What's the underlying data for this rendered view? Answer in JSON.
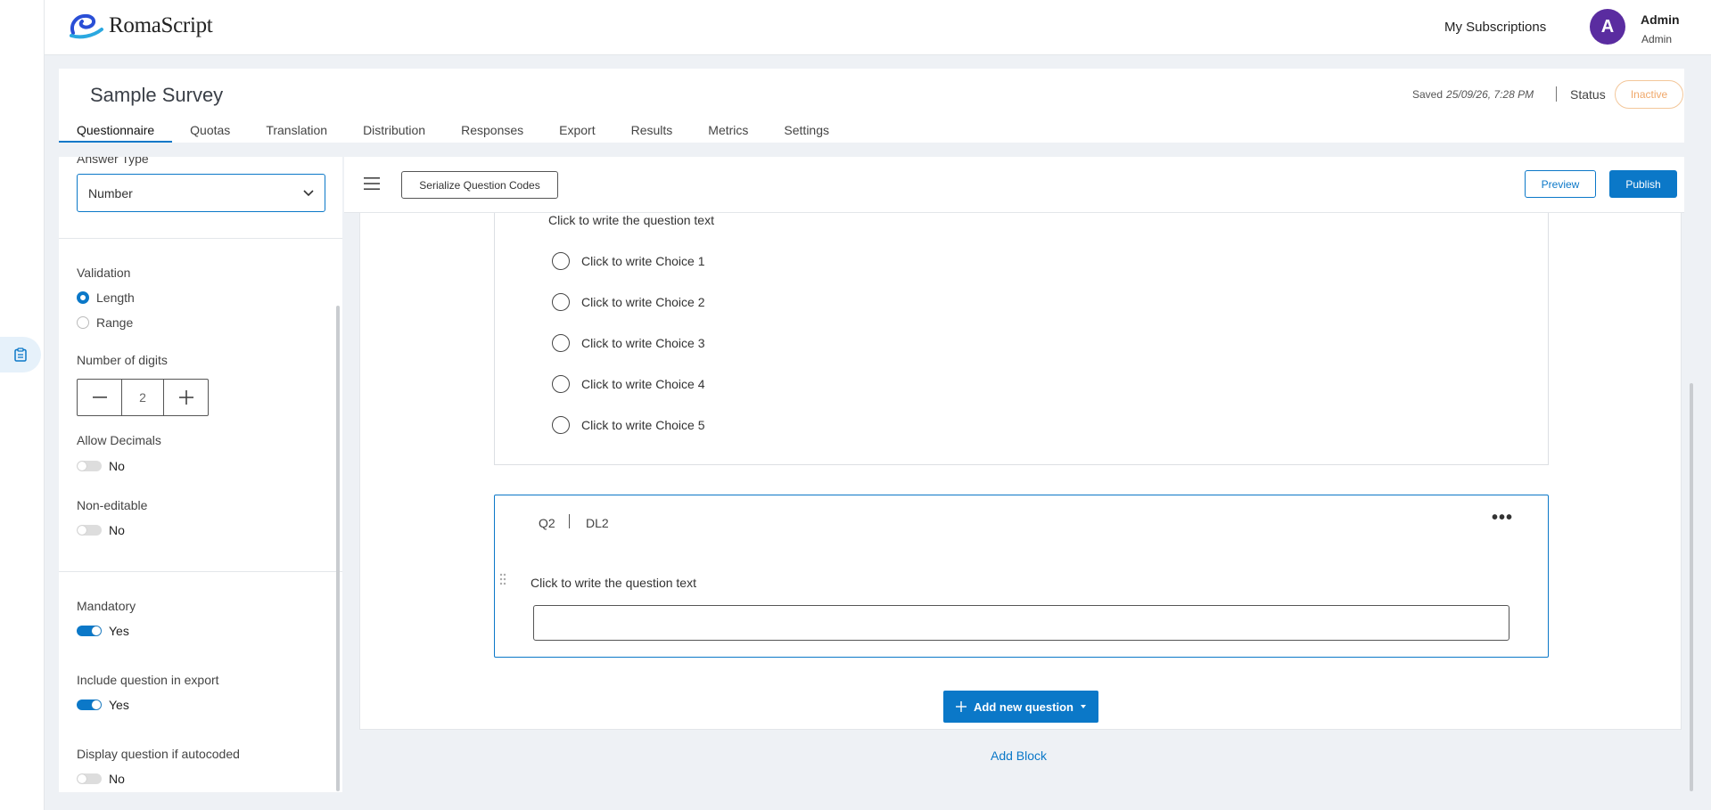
{
  "app": {
    "logo_text": "RomaScript"
  },
  "header": {
    "my_subscriptions": "My Subscriptions",
    "avatar_initial": "A",
    "user_name": "Admin",
    "user_role": "Admin"
  },
  "survey": {
    "title": "Sample Survey",
    "saved_label": "Saved",
    "saved_time": "25/09/26, 7:28 PM",
    "status_label": "Status",
    "status_value": "Inactive",
    "tabs": [
      "Questionnaire",
      "Quotas",
      "Translation",
      "Distribution",
      "Responses",
      "Export",
      "Results",
      "Metrics",
      "Settings"
    ],
    "active_tab": "Questionnaire"
  },
  "settings": {
    "answer_type_label": "Answer Type",
    "answer_type_value": "Number",
    "validation_label": "Validation",
    "validation_options": [
      "Length",
      "Range"
    ],
    "validation_selected": "Length",
    "digits_label": "Number of digits",
    "digits_value": "2",
    "allow_decimals_label": "Allow Decimals",
    "allow_decimals_value": "No",
    "non_editable_label": "Non-editable",
    "non_editable_value": "No",
    "mandatory_label": "Mandatory",
    "mandatory_value": "Yes",
    "include_export_label": "Include question in export",
    "include_export_value": "Yes",
    "display_autocoded_label": "Display question if autocoded",
    "display_autocoded_value": "No"
  },
  "toolbar": {
    "serialize_label": "Serialize Question Codes",
    "preview_label": "Preview",
    "publish_label": "Publish"
  },
  "questions": {
    "q1": {
      "text": "Click to write the question text",
      "choices": [
        "Click to write Choice 1",
        "Click to write Choice 2",
        "Click to write Choice 3",
        "Click to write Choice 4",
        "Click to write Choice 5"
      ]
    },
    "q2": {
      "code": "Q2",
      "type": "DL2",
      "text": "Click to write the question text",
      "input_value": ""
    }
  },
  "actions": {
    "add_question_label": "Add new question",
    "add_block_label": "Add Block"
  },
  "colors": {
    "accent": "#0b78c8",
    "avatar": "#5a2ca0",
    "inactive": "#f0a86a"
  }
}
